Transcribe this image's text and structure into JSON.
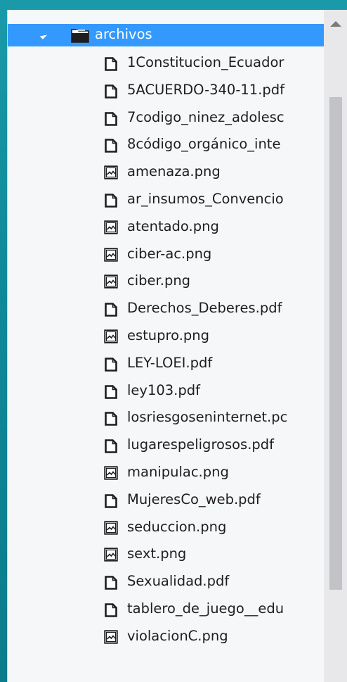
{
  "tree": {
    "folder": {
      "label": "archivos",
      "icon": "folder-open-icon",
      "expanded": true
    },
    "files": [
      {
        "label": "1Constitucion_Ecuador",
        "icon": "document-file-icon"
      },
      {
        "label": "5ACUERDO-340-11.pdf",
        "icon": "document-file-icon"
      },
      {
        "label": "7codigo_ninez_adolesc",
        "icon": "document-file-icon"
      },
      {
        "label": "8código_orgánico_inte",
        "icon": "document-file-icon"
      },
      {
        "label": "amenaza.png",
        "icon": "image-file-icon"
      },
      {
        "label": "ar_insumos_Convencio",
        "icon": "document-file-icon"
      },
      {
        "label": "atentado.png",
        "icon": "image-file-icon"
      },
      {
        "label": "ciber-ac.png",
        "icon": "image-file-icon"
      },
      {
        "label": "ciber.png",
        "icon": "image-file-icon"
      },
      {
        "label": "Derechos_Deberes.pdf",
        "icon": "document-file-icon"
      },
      {
        "label": "estupro.png",
        "icon": "image-file-icon"
      },
      {
        "label": "LEY-LOEI.pdf",
        "icon": "document-file-icon"
      },
      {
        "label": "ley103.pdf",
        "icon": "document-file-icon"
      },
      {
        "label": "losriesgoseninternet.pc",
        "icon": "document-file-icon"
      },
      {
        "label": "lugarespeligrosos.pdf",
        "icon": "document-file-icon"
      },
      {
        "label": "manipulac.png",
        "icon": "image-file-icon"
      },
      {
        "label": "MujeresCo_web.pdf",
        "icon": "document-file-icon"
      },
      {
        "label": "seduccion.png",
        "icon": "image-file-icon"
      },
      {
        "label": "sext.png",
        "icon": "image-file-icon"
      },
      {
        "label": "Sexualidad.pdf",
        "icon": "document-file-icon"
      },
      {
        "label": "tablero_de_juego__edu",
        "icon": "document-file-icon"
      },
      {
        "label": "violacionC.png",
        "icon": "image-file-icon"
      }
    ]
  },
  "colors": {
    "selection": "#3399ff",
    "panel_background": "#f6f7f9",
    "scroll_thumb": "#c2c3c6",
    "backdrop": "#0f8a99"
  }
}
